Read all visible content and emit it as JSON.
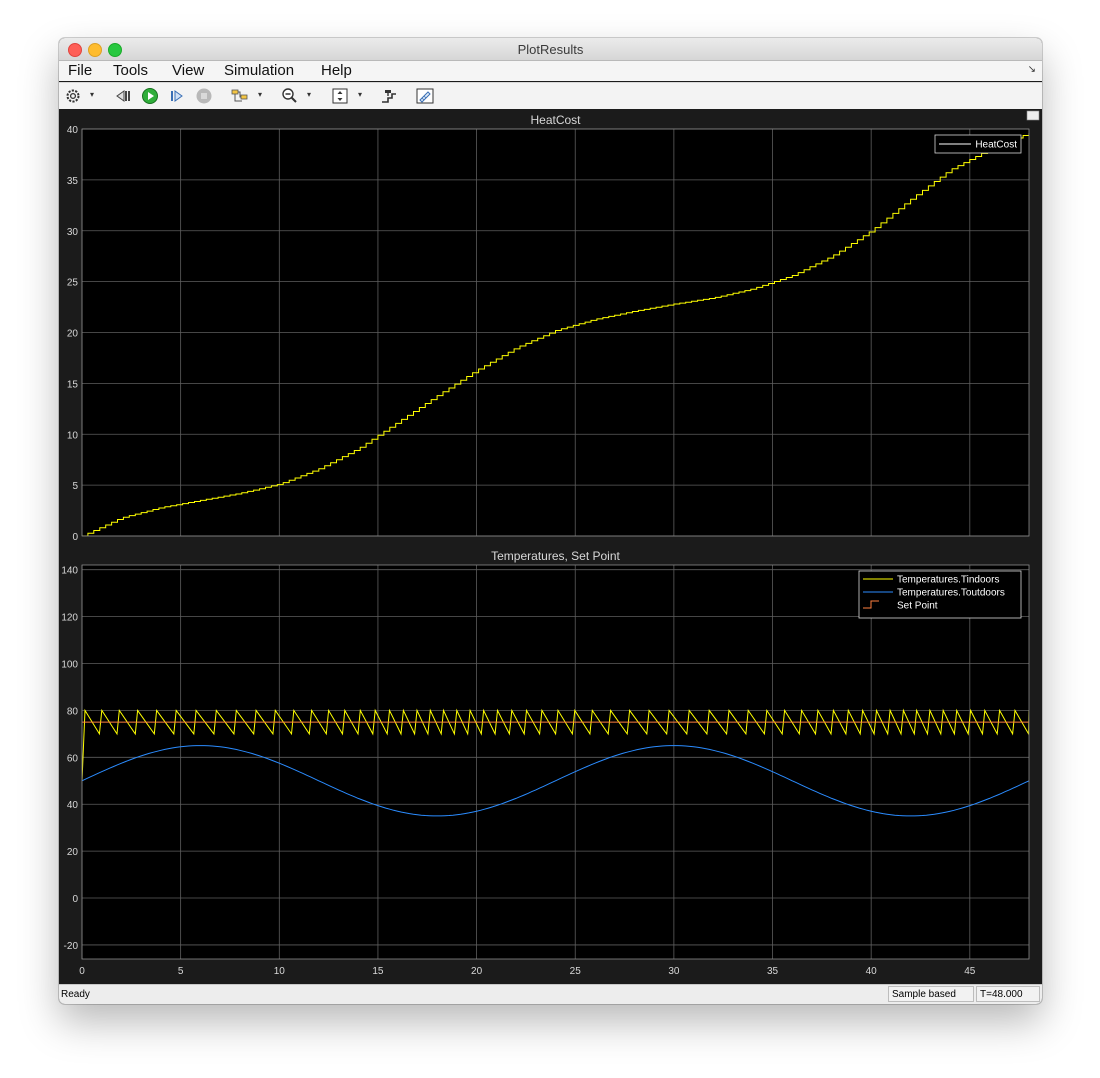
{
  "window": {
    "title": "PlotResults"
  },
  "menu": {
    "items": [
      "File",
      "Tools",
      "View",
      "Simulation",
      "Help"
    ]
  },
  "toolbar": {
    "icons": [
      "gear-icon",
      "step-back-icon",
      "run-icon",
      "step-forward-icon",
      "stop-icon",
      "signal-selector-icon",
      "zoom-out-icon",
      "autoscale-icon",
      "legend-icon",
      "measure-icon"
    ]
  },
  "colors": {
    "tindoors": "#ffff00",
    "toutdoors": "#2b8cff",
    "setpoint": "#ff7f3f",
    "heatcost": "#ffff00"
  },
  "chart_data": [
    {
      "type": "line",
      "title": "HeatCost",
      "xlim": [
        0,
        48
      ],
      "ylim": [
        0,
        40
      ],
      "xticks": [
        0,
        5,
        10,
        15,
        20,
        25,
        30,
        35,
        40,
        45
      ],
      "yticks": [
        0,
        5,
        10,
        15,
        20,
        25,
        30,
        35,
        40
      ],
      "grid": true,
      "legend_position": "top-right",
      "series": [
        {
          "name": "HeatCost",
          "style": "stairs",
          "x": [
            0,
            2,
            4,
            6,
            8,
            10,
            12,
            14,
            16,
            18,
            20,
            22,
            24,
            26,
            28,
            30,
            32,
            34,
            36,
            38,
            40,
            42,
            44,
            46,
            48
          ],
          "y": [
            0,
            1.8,
            2.8,
            3.5,
            4.2,
            5.1,
            6.6,
            8.6,
            11.2,
            13.8,
            16.3,
            18.5,
            20.2,
            21.3,
            22.1,
            22.8,
            23.4,
            24.3,
            25.6,
            27.5,
            30,
            33.1,
            36.0,
            38.0,
            39.6
          ]
        }
      ]
    },
    {
      "type": "line",
      "title": "Temperatures, Set Point",
      "xlim": [
        0,
        48
      ],
      "ylim": [
        -26,
        142
      ],
      "xticks": [
        0,
        5,
        10,
        15,
        20,
        25,
        30,
        35,
        40,
        45
      ],
      "yticks": [
        -20,
        0,
        20,
        40,
        60,
        80,
        100,
        120,
        140
      ],
      "grid": true,
      "legend_position": "top-right",
      "series": [
        {
          "name": "Temperatures.Tindoors",
          "style": "sawtooth",
          "range": [
            70,
            80
          ]
        },
        {
          "name": "Temperatures.Toutdoors",
          "style": "sine",
          "mean": 50,
          "amplitude": 15,
          "period": 24,
          "x_at_max": 6
        },
        {
          "name": "Set Point",
          "style": "stairs",
          "value": 75
        }
      ]
    }
  ],
  "status": {
    "ready": "Ready",
    "mode": "Sample based",
    "time": "T=48.000"
  }
}
